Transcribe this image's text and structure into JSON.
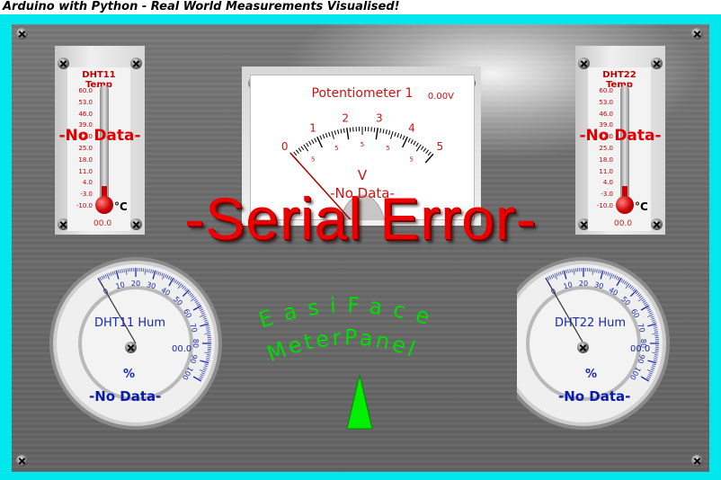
{
  "window": {
    "title": "Arduino with Python - Real World Measurements Visualised!"
  },
  "thermometers": [
    {
      "title": "DHT11 Temp",
      "status": "-No Data-",
      "value": "00.0",
      "unit": "°C",
      "scale": [
        "60.0",
        "53.0",
        "46.0",
        "39.0",
        "32.0",
        "25.0",
        "18.0",
        "11.0",
        "4.0",
        "-3.0",
        "-10.0"
      ]
    },
    {
      "title": "DHT22 Temp",
      "status": "-No Data-",
      "value": "00.0",
      "unit": "°C",
      "scale": [
        "60.0",
        "53.0",
        "46.0",
        "39.0",
        "32.0",
        "25.0",
        "18.0",
        "11.0",
        "4.0",
        "-3.0",
        "-10.0"
      ]
    }
  ],
  "voltmeter": {
    "title": "Potentiometer 1",
    "reading": "0.00V",
    "unit": "V",
    "status": "-No Data-",
    "major_ticks": [
      "0",
      "1",
      "2",
      "3",
      "4",
      "5"
    ],
    "minor_ticks": [
      "5",
      "5",
      "5",
      "5",
      "5"
    ],
    "level": 0
  },
  "error_banner": "-Serial Error-",
  "humidity_gauges": [
    {
      "title": "DHT11 Hum",
      "value": "00.0",
      "unit": "%",
      "status": "-No Data-",
      "ticks": [
        "0",
        "10",
        "20",
        "30",
        "40",
        "50",
        "60",
        "70",
        "80",
        "90",
        "100"
      ]
    },
    {
      "title": "DHT22 Hum",
      "value": "00.0",
      "unit": "%",
      "status": "-No Data-",
      "ticks": [
        "0",
        "10",
        "20",
        "30",
        "40",
        "50",
        "60",
        "70",
        "80",
        "90",
        "100"
      ]
    }
  ],
  "logo": {
    "line1": "EasiFace",
    "line2": "MeterPanel",
    "color": "#00dd00"
  },
  "colors": {
    "frame": "#00e8ee",
    "error": "#ee0000",
    "gauge_text": "#1a2aa8",
    "logo": "#00dd00"
  },
  "icons": [
    "screw-icon",
    "thermometer-bulb-icon",
    "pointer-triangle-icon"
  ]
}
